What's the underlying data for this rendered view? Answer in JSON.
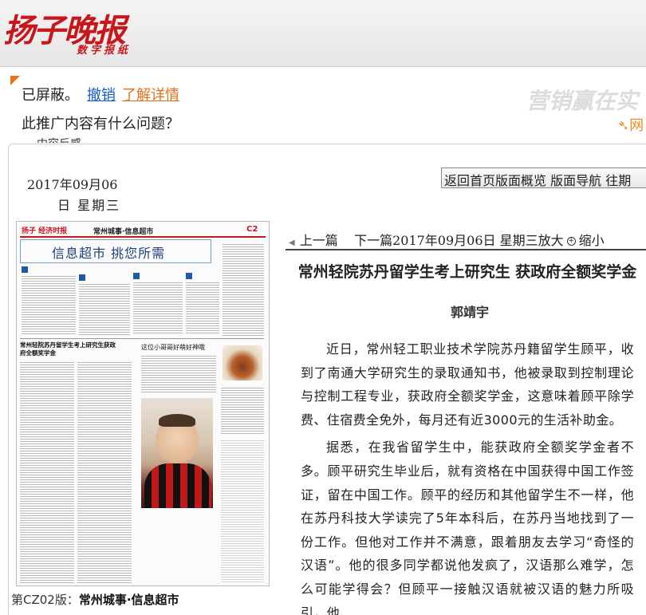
{
  "masthead": {
    "logo_main": "扬子晚报",
    "logo_sub": "数字报纸"
  },
  "ad_notice": {
    "blocked_text": "已屏蔽。",
    "undo_link": "撤销",
    "learn_more_link": "了解详情",
    "question": "此推广内容有什么问题？",
    "option_partial": "内容反感",
    "brand_watermark": "营销赢在实",
    "brand_tail": "网"
  },
  "sidebar": {
    "date": "2017年09月06",
    "weekday": "日 星期三"
  },
  "top_nav": {
    "items": [
      "返回首页",
      "版面概览",
      "版面导航",
      "往期"
    ]
  },
  "page_thumbnail": {
    "brand": "扬子 经济时报",
    "section": "常州城事·信息超市",
    "page_no": "C2",
    "title": "信息超市 挑您所需",
    "story_title": "常州轻院苏丹留学生考上研究生获政府全额奖学金",
    "photo_title": "这位小哥哥好萌好神哦"
  },
  "page_caption": {
    "label": "第CZ02版：",
    "section": "常州城事·信息超市"
  },
  "article_nav": {
    "prev": "上一篇",
    "next": "下一篇",
    "date": "2017年09月06日 星期三",
    "zoom_in": "放大",
    "zoom_out": "缩小"
  },
  "article": {
    "title": "常州轻院苏丹留学生考上研究生 获政府全额奖学金",
    "author": "郭靖宇",
    "paragraphs": [
      "近日，常州轻工职业技术学院苏丹籍留学生顾平，收到了南通大学研究生的录取通知书，他被录取到控制理论与控制工程专业，获政府全额奖学金，这意味着顾平除学费、住宿费全免外，每月还有近3000元的生活补助金。",
      "据悉，在我省留学生中，能获政府全额奖学金者不多。顾平研究生毕业后，就有资格在中国获得中国工作签证，留在中国工作。顾平的经历和其他留学生不一样，他在苏丹科技大学读完了5年本科后，在苏丹当地找到了一份工作。但他对工作并不满意，跟着朋友去学习“奇怪的汉语”。他的很多同学都说他发疯了，汉语那么难学，怎么可能学得会？但顾平一接触汉语就被汉语的魅力所吸引，他"
    ]
  },
  "colors": {
    "brand_red": "#c8161d",
    "link_blue": "#1a5bc4",
    "link_orange": "#e0701c"
  }
}
